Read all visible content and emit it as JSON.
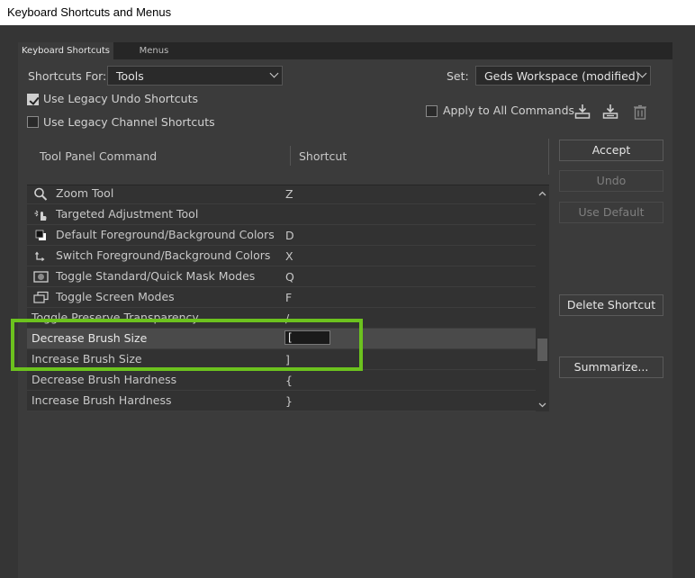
{
  "window": {
    "title": "Keyboard Shortcuts and Menus"
  },
  "tabs": [
    {
      "label": "Keyboard Shortcuts"
    },
    {
      "label": "Menus"
    }
  ],
  "shortcuts_for": {
    "label": "Shortcuts For:",
    "value": "Tools"
  },
  "set": {
    "label": "Set:",
    "value": "Geds Workspace (modified)"
  },
  "options": {
    "legacy_undo": {
      "label": "Use Legacy Undo Shortcuts",
      "checked": true
    },
    "legacy_channel": {
      "label": "Use Legacy Channel Shortcuts",
      "checked": false
    },
    "apply_all": {
      "label": "Apply to All Commands",
      "checked": false
    }
  },
  "icons": {
    "save_set": "save-set-icon",
    "new_set": "new-set-icon",
    "delete_set": "trash-icon"
  },
  "table": {
    "col_command": "Tool Panel Command",
    "col_shortcut": "Shortcut",
    "rows": [
      {
        "name": "Zoom Tool",
        "shortcut": "Z",
        "icon": "zoom-icon"
      },
      {
        "name": "Targeted Adjustment Tool",
        "shortcut": "",
        "icon": "targeted-adjustment-icon"
      },
      {
        "name": "Default Foreground/Background Colors",
        "shortcut": "D",
        "icon": "default-colors-icon"
      },
      {
        "name": "Switch Foreground/Background Colors",
        "shortcut": "X",
        "icon": "switch-colors-icon"
      },
      {
        "name": "Toggle Standard/Quick Mask Modes",
        "shortcut": "Q",
        "icon": "quick-mask-icon"
      },
      {
        "name": "Toggle Screen Modes",
        "shortcut": "F",
        "icon": "screen-modes-icon"
      },
      {
        "name": "Toggle Preserve Transparency",
        "shortcut": "/",
        "icon": ""
      },
      {
        "name": "Decrease Brush Size",
        "shortcut": "[",
        "icon": ""
      },
      {
        "name": "Increase Brush Size",
        "shortcut": "]",
        "icon": ""
      },
      {
        "name": "Decrease Brush Hardness",
        "shortcut": "{",
        "icon": ""
      },
      {
        "name": "Increase Brush Hardness",
        "shortcut": "}",
        "icon": ""
      }
    ]
  },
  "buttons": {
    "accept": "Accept",
    "undo": "Undo",
    "use_default": "Use Default",
    "delete_shortcut": "Delete Shortcut",
    "summarize": "Summarize..."
  },
  "colors": {
    "highlight": "#6cc21e",
    "panel": "#3b3b3b"
  }
}
